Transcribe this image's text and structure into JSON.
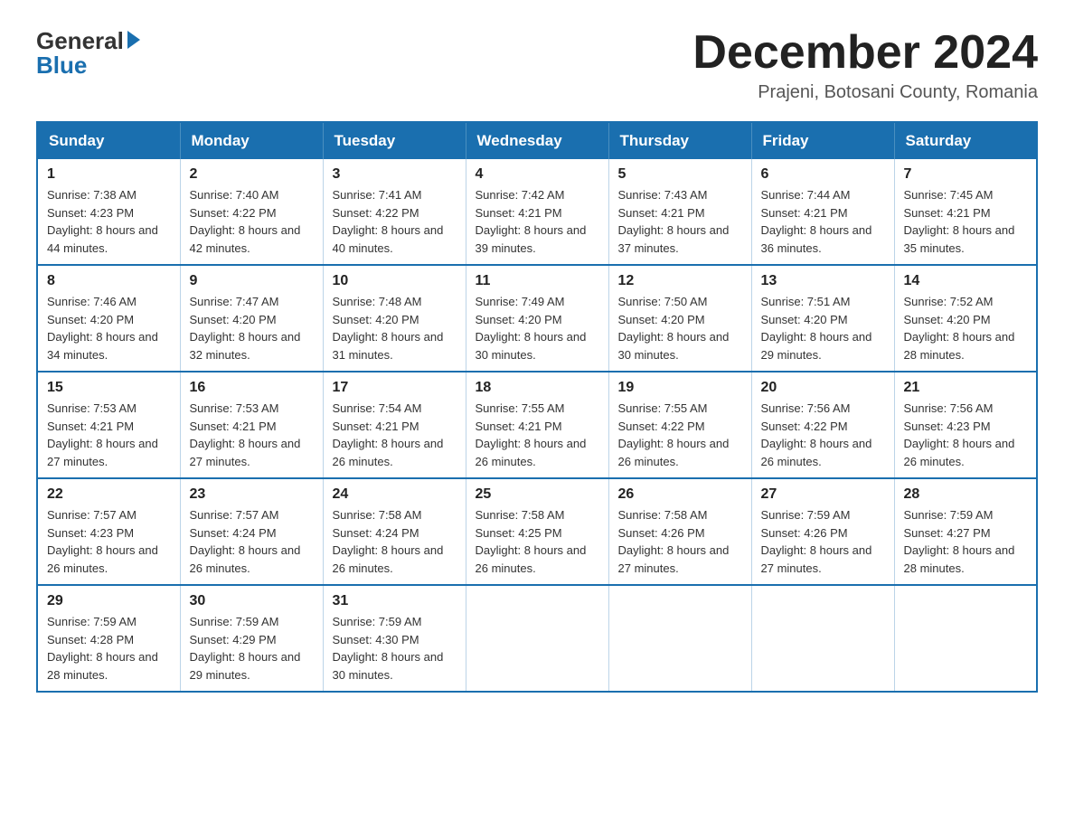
{
  "header": {
    "logo_general": "General",
    "logo_blue": "Blue",
    "month_title": "December 2024",
    "location": "Prajeni, Botosani County, Romania"
  },
  "days_of_week": [
    "Sunday",
    "Monday",
    "Tuesday",
    "Wednesday",
    "Thursday",
    "Friday",
    "Saturday"
  ],
  "weeks": [
    [
      {
        "day": "1",
        "sunrise": "7:38 AM",
        "sunset": "4:23 PM",
        "daylight": "8 hours and 44 minutes."
      },
      {
        "day": "2",
        "sunrise": "7:40 AM",
        "sunset": "4:22 PM",
        "daylight": "8 hours and 42 minutes."
      },
      {
        "day": "3",
        "sunrise": "7:41 AM",
        "sunset": "4:22 PM",
        "daylight": "8 hours and 40 minutes."
      },
      {
        "day": "4",
        "sunrise": "7:42 AM",
        "sunset": "4:21 PM",
        "daylight": "8 hours and 39 minutes."
      },
      {
        "day": "5",
        "sunrise": "7:43 AM",
        "sunset": "4:21 PM",
        "daylight": "8 hours and 37 minutes."
      },
      {
        "day": "6",
        "sunrise": "7:44 AM",
        "sunset": "4:21 PM",
        "daylight": "8 hours and 36 minutes."
      },
      {
        "day": "7",
        "sunrise": "7:45 AM",
        "sunset": "4:21 PM",
        "daylight": "8 hours and 35 minutes."
      }
    ],
    [
      {
        "day": "8",
        "sunrise": "7:46 AM",
        "sunset": "4:20 PM",
        "daylight": "8 hours and 34 minutes."
      },
      {
        "day": "9",
        "sunrise": "7:47 AM",
        "sunset": "4:20 PM",
        "daylight": "8 hours and 32 minutes."
      },
      {
        "day": "10",
        "sunrise": "7:48 AM",
        "sunset": "4:20 PM",
        "daylight": "8 hours and 31 minutes."
      },
      {
        "day": "11",
        "sunrise": "7:49 AM",
        "sunset": "4:20 PM",
        "daylight": "8 hours and 30 minutes."
      },
      {
        "day": "12",
        "sunrise": "7:50 AM",
        "sunset": "4:20 PM",
        "daylight": "8 hours and 30 minutes."
      },
      {
        "day": "13",
        "sunrise": "7:51 AM",
        "sunset": "4:20 PM",
        "daylight": "8 hours and 29 minutes."
      },
      {
        "day": "14",
        "sunrise": "7:52 AM",
        "sunset": "4:20 PM",
        "daylight": "8 hours and 28 minutes."
      }
    ],
    [
      {
        "day": "15",
        "sunrise": "7:53 AM",
        "sunset": "4:21 PM",
        "daylight": "8 hours and 27 minutes."
      },
      {
        "day": "16",
        "sunrise": "7:53 AM",
        "sunset": "4:21 PM",
        "daylight": "8 hours and 27 minutes."
      },
      {
        "day": "17",
        "sunrise": "7:54 AM",
        "sunset": "4:21 PM",
        "daylight": "8 hours and 26 minutes."
      },
      {
        "day": "18",
        "sunrise": "7:55 AM",
        "sunset": "4:21 PM",
        "daylight": "8 hours and 26 minutes."
      },
      {
        "day": "19",
        "sunrise": "7:55 AM",
        "sunset": "4:22 PM",
        "daylight": "8 hours and 26 minutes."
      },
      {
        "day": "20",
        "sunrise": "7:56 AM",
        "sunset": "4:22 PM",
        "daylight": "8 hours and 26 minutes."
      },
      {
        "day": "21",
        "sunrise": "7:56 AM",
        "sunset": "4:23 PM",
        "daylight": "8 hours and 26 minutes."
      }
    ],
    [
      {
        "day": "22",
        "sunrise": "7:57 AM",
        "sunset": "4:23 PM",
        "daylight": "8 hours and 26 minutes."
      },
      {
        "day": "23",
        "sunrise": "7:57 AM",
        "sunset": "4:24 PM",
        "daylight": "8 hours and 26 minutes."
      },
      {
        "day": "24",
        "sunrise": "7:58 AM",
        "sunset": "4:24 PM",
        "daylight": "8 hours and 26 minutes."
      },
      {
        "day": "25",
        "sunrise": "7:58 AM",
        "sunset": "4:25 PM",
        "daylight": "8 hours and 26 minutes."
      },
      {
        "day": "26",
        "sunrise": "7:58 AM",
        "sunset": "4:26 PM",
        "daylight": "8 hours and 27 minutes."
      },
      {
        "day": "27",
        "sunrise": "7:59 AM",
        "sunset": "4:26 PM",
        "daylight": "8 hours and 27 minutes."
      },
      {
        "day": "28",
        "sunrise": "7:59 AM",
        "sunset": "4:27 PM",
        "daylight": "8 hours and 28 minutes."
      }
    ],
    [
      {
        "day": "29",
        "sunrise": "7:59 AM",
        "sunset": "4:28 PM",
        "daylight": "8 hours and 28 minutes."
      },
      {
        "day": "30",
        "sunrise": "7:59 AM",
        "sunset": "4:29 PM",
        "daylight": "8 hours and 29 minutes."
      },
      {
        "day": "31",
        "sunrise": "7:59 AM",
        "sunset": "4:30 PM",
        "daylight": "8 hours and 30 minutes."
      },
      null,
      null,
      null,
      null
    ]
  ]
}
